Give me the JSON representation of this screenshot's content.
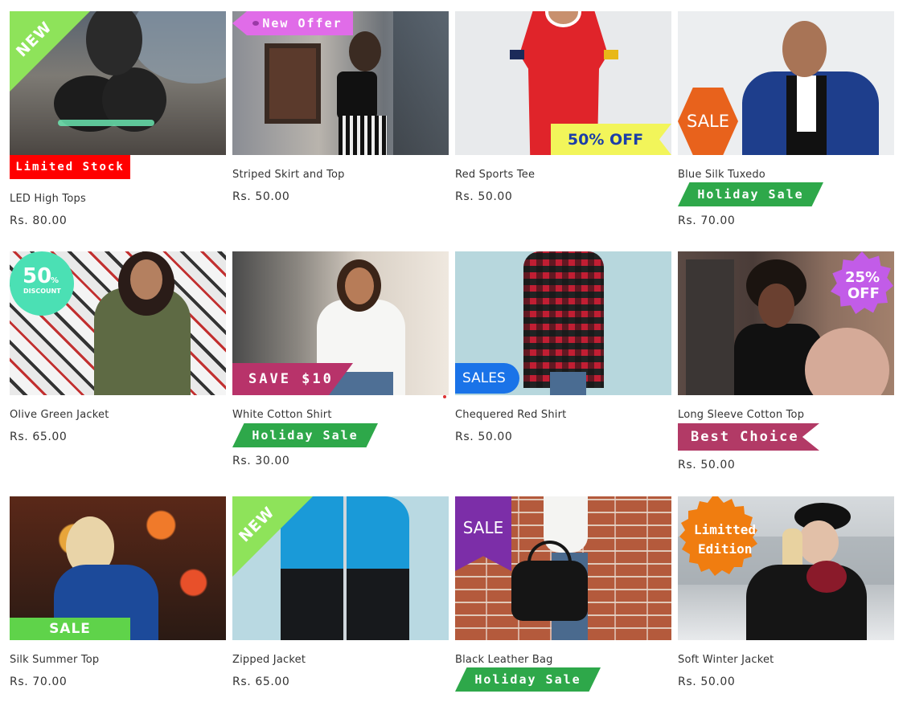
{
  "products": [
    {
      "title": "LED High Tops",
      "price": "Rs. 80.00",
      "badges": [
        "NEW",
        "Limited Stock"
      ]
    },
    {
      "title": "Striped Skirt and Top",
      "price": "Rs. 50.00",
      "badges": [
        "New Offer"
      ]
    },
    {
      "title": "Red Sports Tee",
      "price": "Rs. 50.00",
      "badges": [
        "50% OFF"
      ]
    },
    {
      "title": "Blue Silk Tuxedo",
      "price": "Rs. 70.00",
      "badges": [
        "SALE",
        "Holiday Sale"
      ]
    },
    {
      "title": "Olive Green Jacket",
      "price": "Rs. 65.00",
      "badges": [
        "50",
        "%",
        "DISCOUNT"
      ]
    },
    {
      "title": "White Cotton Shirt",
      "price": "Rs. 30.00",
      "badges": [
        "SAVE $10",
        "Holiday Sale"
      ]
    },
    {
      "title": "Chequered Red Shirt",
      "price": "Rs. 50.00",
      "badges": [
        "SALES"
      ]
    },
    {
      "title": "Long Sleeve Cotton Top",
      "price": "Rs. 50.00",
      "badges": [
        "25%",
        "OFF",
        "Best Choice"
      ]
    },
    {
      "title": "Silk Summer Top",
      "price": "Rs. 70.00",
      "badges": [
        "SALE"
      ]
    },
    {
      "title": "Zipped Jacket",
      "price": "Rs. 65.00",
      "badges": [
        "NEW"
      ]
    },
    {
      "title": "Black Leather Bag",
      "price": "",
      "badges": [
        "SALE",
        "Holiday Sale"
      ]
    },
    {
      "title": "Soft Winter Jacket",
      "price": "Rs. 50.00",
      "badges": [
        "Limitted",
        "Edition"
      ]
    }
  ],
  "colors": {
    "green_corner": "#8ee35a",
    "red_strip": "#ff0000",
    "pink_tag": "#e06ce8",
    "yellow_tag": "#f2f55a",
    "orange_hex": "#e8621c",
    "holiday_green": "#2ea84a",
    "teal_circle": "#4be0b4",
    "magenta_strip": "#b8336a",
    "blue_tag": "#1a73e8",
    "purple_burst": "#c25ce8",
    "best_choice": "#b23a66",
    "sale_green": "#5fd34a",
    "purple_ribbon": "#7c2ea8",
    "orange_burst": "#f07d10"
  }
}
